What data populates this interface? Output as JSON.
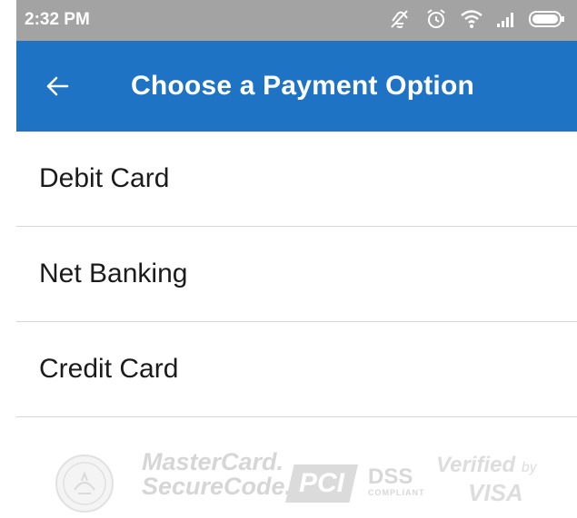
{
  "status_bar": {
    "time": "2:32 PM",
    "icons": [
      "mute-icon",
      "alarm-icon",
      "wifi-icon",
      "signal-icon",
      "battery-icon"
    ]
  },
  "app_bar": {
    "title": "Choose a Payment Option",
    "back_icon": "arrow-left-icon",
    "color": "#1f73c4"
  },
  "payment_options": [
    {
      "label": "Debit Card"
    },
    {
      "label": "Net Banking"
    },
    {
      "label": "Credit Card"
    }
  ],
  "trust_badges": {
    "mastercard_line1": "MasterCard.",
    "mastercard_line2": "SecureCode.",
    "pci": "PCI",
    "dss": "DSS",
    "dss_sub": "COMPLIANT",
    "verified_by": "Verified",
    "verified_by_suffix": "by",
    "visa": "VISA"
  }
}
